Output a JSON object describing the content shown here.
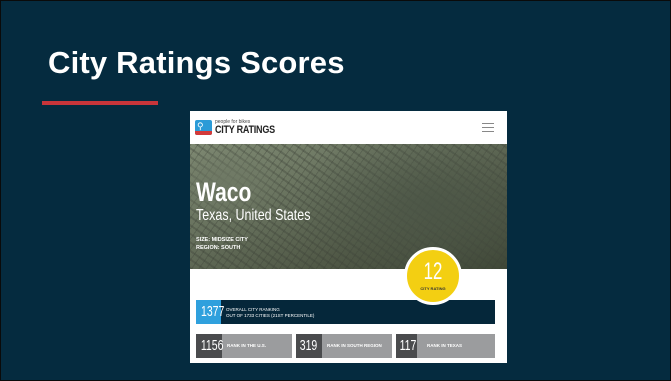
{
  "slide": {
    "title": "City Ratings Scores",
    "accent_color": "#c8353a",
    "background_color": "#052b3f"
  },
  "site": {
    "logo": {
      "top_text": "people for bikes",
      "main_text": "CITY RATINGS",
      "icon": "bike-icon"
    },
    "menu_icon": "hamburger-menu-icon",
    "hero": {
      "city": "Waco",
      "state": "Texas, United States",
      "size": "SIZE: MIDSIZE CITY",
      "region": "REGION: SOUTH"
    },
    "rating": {
      "value": "12",
      "label": "CITY RATING",
      "color": "#f3cf12"
    },
    "overall": {
      "rank": "1377",
      "line1": "OVERALL CITY RANKING",
      "line2": "OUT OF 1733 CITIES (21ST PERCENTILE)"
    },
    "ranks": [
      {
        "value": "1156",
        "label": "RANK IN THE U.S."
      },
      {
        "value": "319",
        "label": "RANK IN SOUTH REGION"
      },
      {
        "value": "117",
        "label": "RANK IN TEXAS"
      }
    ]
  }
}
